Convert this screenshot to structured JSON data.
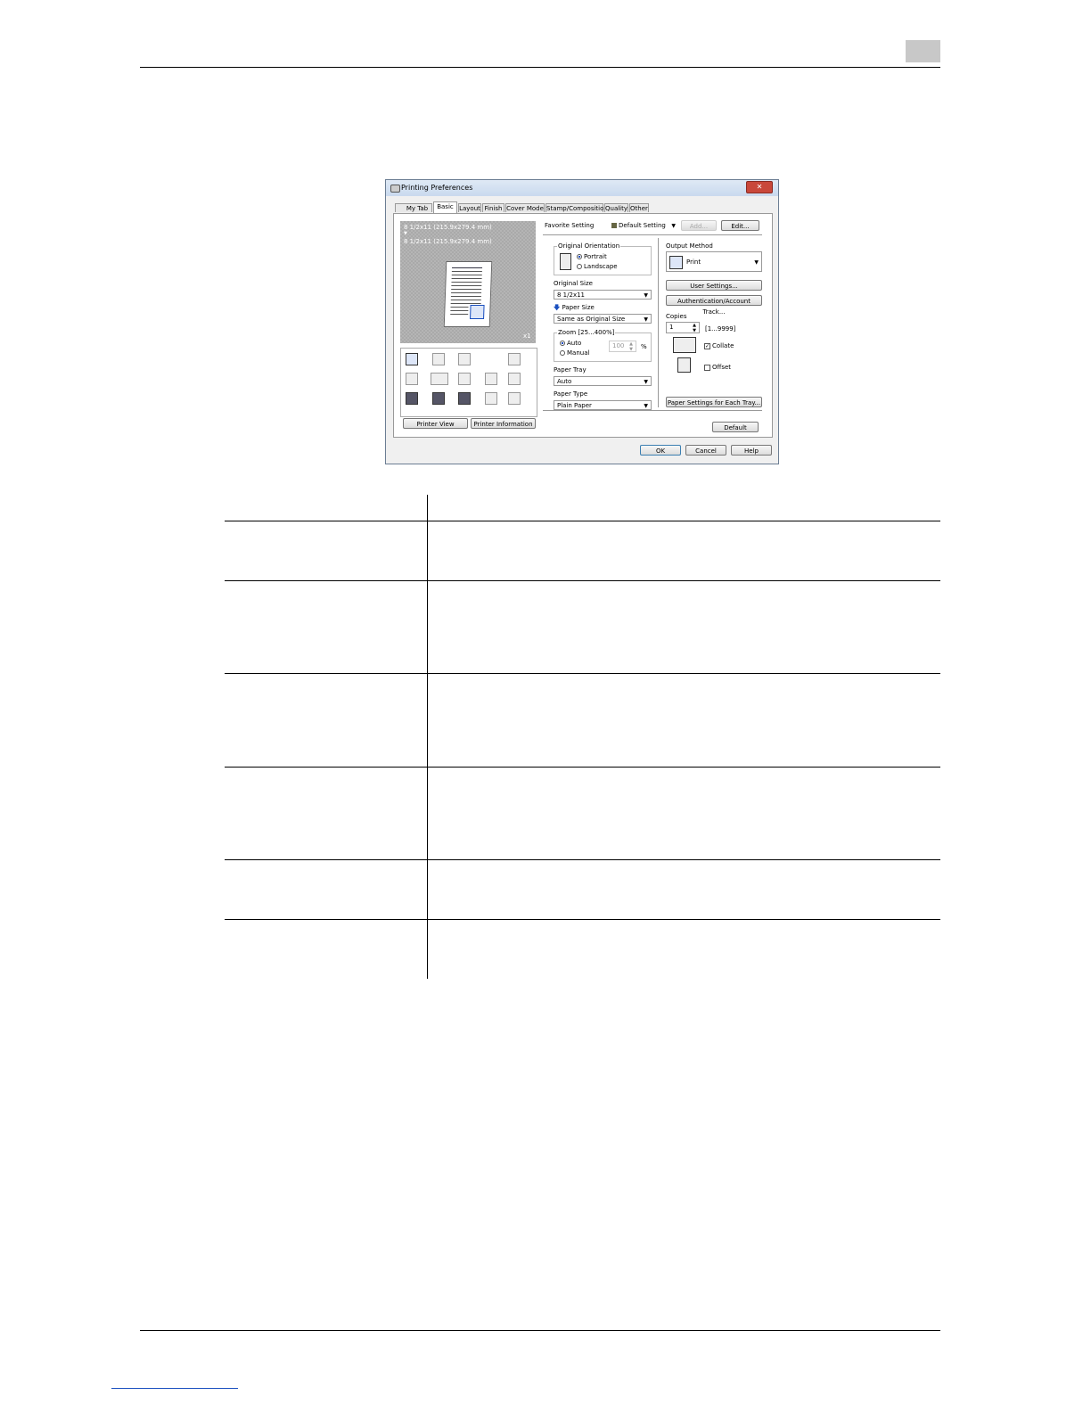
{
  "page": {
    "chapter_box_color": "#c8c8c8",
    "footer_link_color": "#1a4fbf"
  },
  "dialog": {
    "title": "Printing Preferences",
    "close_glyph": "✕",
    "tabs": [
      "My Tab",
      "Basic",
      "Layout",
      "Finish",
      "Cover Mode",
      "Stamp/Composition",
      "Quality",
      "Other"
    ],
    "active_tab": "Basic",
    "preview": {
      "original_size_line": "8 1/2x11 (215.9x279.4 mm)",
      "arrow": "▼",
      "paper_size_line": "8 1/2x11 (215.9x279.4 mm)",
      "copies_badge": "x1"
    },
    "printer_view_button": "Printer View",
    "printer_information_button": "Printer Information",
    "favorite_setting_label": "Favorite Setting",
    "favorite_setting_value": "Default Setting",
    "add_button": "Add...",
    "edit_button": "Edit...",
    "original_orientation_label": "Original Orientation",
    "portrait_label": "Portrait",
    "landscape_label": "Landscape",
    "orientation_selected": "Portrait",
    "original_size_label": "Original Size",
    "original_size_value": "8 1/2x11",
    "paper_size_label": "Paper Size",
    "paper_size_value": "Same as Original Size",
    "zoom_label": "Zoom [25...400%]",
    "zoom_auto_label": "Auto",
    "zoom_manual_label": "Manual",
    "zoom_selected": "Auto",
    "zoom_value": "100",
    "zoom_unit": "%",
    "paper_tray_label": "Paper Tray",
    "paper_tray_value": "Auto",
    "paper_type_label": "Paper Type",
    "paper_type_value": "Plain Paper",
    "output_method_label": "Output Method",
    "output_method_value": "Print",
    "user_settings_button": "User Settings...",
    "authentication_button": "Authentication/Account Track...",
    "copies_label": "Copies",
    "copies_value": "1",
    "copies_range": "[1...9999]",
    "collate_label": "Collate",
    "collate_checked": true,
    "offset_label": "Offset",
    "offset_checked": false,
    "paper_settings_button": "Paper Settings for Each Tray...",
    "default_button": "Default",
    "ok_button": "OK",
    "cancel_button": "Cancel",
    "help_button": "Help"
  }
}
